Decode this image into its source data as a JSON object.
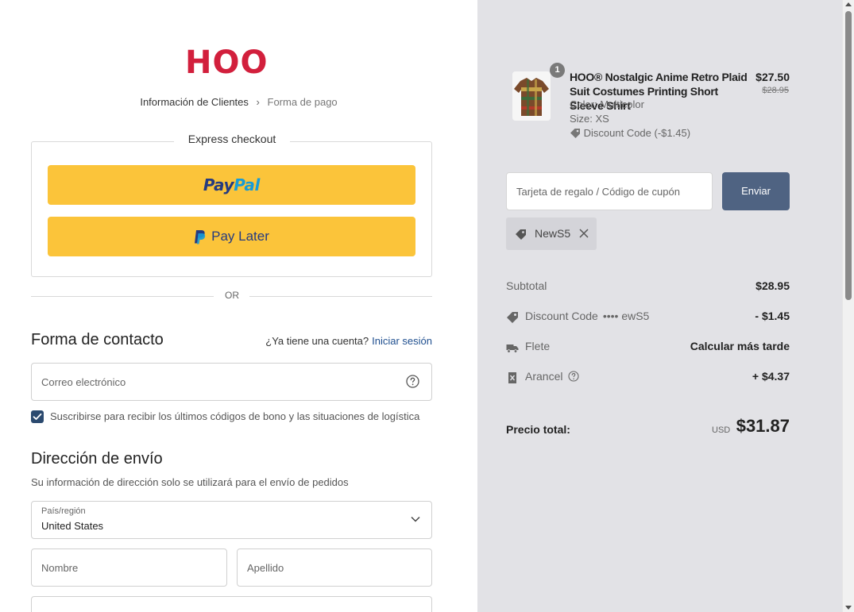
{
  "brand": {
    "logo_text": "HOO",
    "logo_color": "#d21f3c"
  },
  "breadcrumb": {
    "step1": "Información de Clientes",
    "step2": "Forma de pago"
  },
  "express": {
    "title": "Express checkout",
    "paypal_part1": "Pay",
    "paypal_part2": "Pal",
    "pay_later": "Pay Later",
    "or": "OR"
  },
  "contact": {
    "heading": "Forma de contacto",
    "account_q": "¿Ya tiene una cuenta?",
    "login": "Iniciar sesión",
    "email_placeholder": "Correo electrónico",
    "subscribe_label": "Suscribirse para recibir los últimos códigos de bono y las situaciones de logística",
    "subscribe_checked": true
  },
  "shipping": {
    "heading": "Dirección de envío",
    "description": "Su información de dirección solo se utilizará para el envío de pedidos",
    "country_label": "País/región",
    "country_value": "United States",
    "first_name_placeholder": "Nombre",
    "last_name_placeholder": "Apellido"
  },
  "order": {
    "item": {
      "quantity": "1",
      "title": "HOO® Nostalgic Anime Retro Plaid Suit Costumes Printing Short Sleeve Shirt",
      "price": "$27.50",
      "original_price": "$28.95",
      "color": "Color: Multicolor",
      "size": "Size: XS",
      "discount": "Discount Code  (-$1.45)"
    },
    "coupon_placeholder": "Tarjeta de regalo / Código de cupón",
    "send_label": "Enviar",
    "applied_code": "NewS5",
    "subtotal_label": "Subtotal",
    "subtotal_value": "$28.95",
    "discount_label": "Discount Code",
    "discount_code_masked": "•••• ewS5",
    "discount_value": "- $1.45",
    "shipping_label": "Flete",
    "shipping_value": "Calcular más tarde",
    "tariff_label": "Arancel",
    "tariff_value": "+ $4.37",
    "total_label": "Precio total:",
    "total_currency": "USD",
    "total_value": "$31.87"
  },
  "colors": {
    "paypal_yellow": "#fbc43a",
    "send_button": "#4f6382",
    "summary_bg": "#e2e2e6"
  }
}
